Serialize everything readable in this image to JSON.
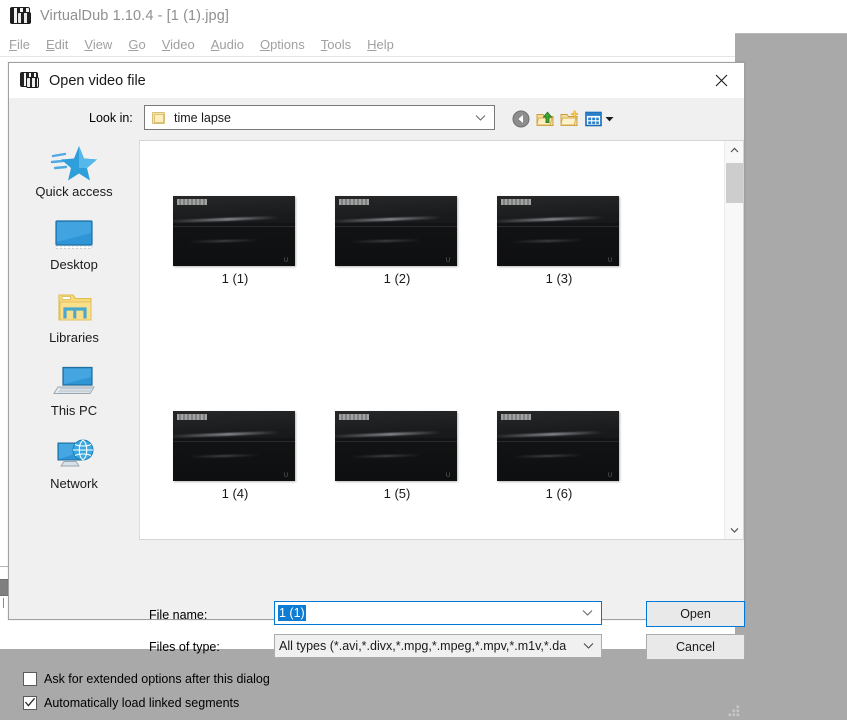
{
  "app": {
    "title": "VirtualDub 1.10.4 - [1 (1).jpg]",
    "icon": "film-reel-icon",
    "menus": [
      {
        "label": "File",
        "accel": "F",
        "rest": "ile"
      },
      {
        "label": "Edit",
        "accel": "E",
        "rest": "dit"
      },
      {
        "label": "View",
        "accel": "V",
        "rest": "iew"
      },
      {
        "label": "Go",
        "accel": "G",
        "rest": "o"
      },
      {
        "label": "Video",
        "accel": "V",
        "rest": "ideo"
      },
      {
        "label": "Audio",
        "accel": "A",
        "rest": "udio"
      },
      {
        "label": "Options",
        "accel": "O",
        "rest": "ptions"
      },
      {
        "label": "Tools",
        "accel": "T",
        "rest": "ools"
      },
      {
        "label": "Help",
        "accel": "H",
        "rest": "elp"
      }
    ]
  },
  "dialog": {
    "title": "Open video file",
    "icon": "film-reel-icon",
    "close_label": "✕",
    "lookin": {
      "label": "Look in:",
      "value": "time lapse",
      "icon": "folder-icon",
      "chevron": "chevron-down-icon"
    },
    "toolbar": [
      {
        "name": "back-button",
        "tooltip": "Back"
      },
      {
        "name": "up-one-level-button",
        "tooltip": "Up one level"
      },
      {
        "name": "new-folder-button",
        "tooltip": "Create New Folder"
      },
      {
        "name": "views-button",
        "tooltip": "Views"
      }
    ],
    "sidebar": {
      "items": [
        {
          "label": "Quick access",
          "icon": "star-icon"
        },
        {
          "label": "Desktop",
          "icon": "monitor-icon"
        },
        {
          "label": "Libraries",
          "icon": "libraries-folder-icon"
        },
        {
          "label": "This PC",
          "icon": "laptop-icon"
        },
        {
          "label": "Network",
          "icon": "network-globe-icon"
        }
      ]
    },
    "filelist": {
      "view": "large-icons",
      "items": [
        {
          "label": "1 (1)",
          "selected": true,
          "row": 0,
          "col": 0
        },
        {
          "label": "1 (2)",
          "selected": false,
          "row": 0,
          "col": 1
        },
        {
          "label": "1 (3)",
          "selected": false,
          "row": 0,
          "col": 2
        },
        {
          "label": "1 (4)",
          "selected": false,
          "row": 1,
          "col": 0
        },
        {
          "label": "1 (5)",
          "selected": false,
          "row": 1,
          "col": 1
        },
        {
          "label": "1 (6)",
          "selected": false,
          "row": 1,
          "col": 2
        }
      ],
      "thumb_mark": "∪",
      "scrollbar": {
        "up_arrow": "chevron-up-icon",
        "down_arrow": "chevron-down-icon",
        "thumb": "scrollbar-thumb"
      }
    },
    "filename": {
      "label": "File name:",
      "value": "1 (1)",
      "selected": true,
      "chevron": "chevron-down-icon"
    },
    "filetype": {
      "label": "Files of type:",
      "value": "All types (*.avi,*.divx,*.mpg,*.mpeg,*.mpv,*.m1v,*.da",
      "chevron": "chevron-down-icon"
    },
    "buttons": {
      "open": "Open",
      "cancel": "Cancel"
    },
    "options": [
      {
        "label": "Ask for extended options after this dialog",
        "checked": false
      },
      {
        "label": "Automatically load linked segments",
        "checked": true
      }
    ],
    "grip": "resize-grip"
  },
  "colors": {
    "accent": "#0078d7",
    "selection": "#0c7cd5",
    "dialog_bg": "#f0f0f0",
    "desktop_bg": "#a9a9a9",
    "timeline_track": "#808080"
  }
}
